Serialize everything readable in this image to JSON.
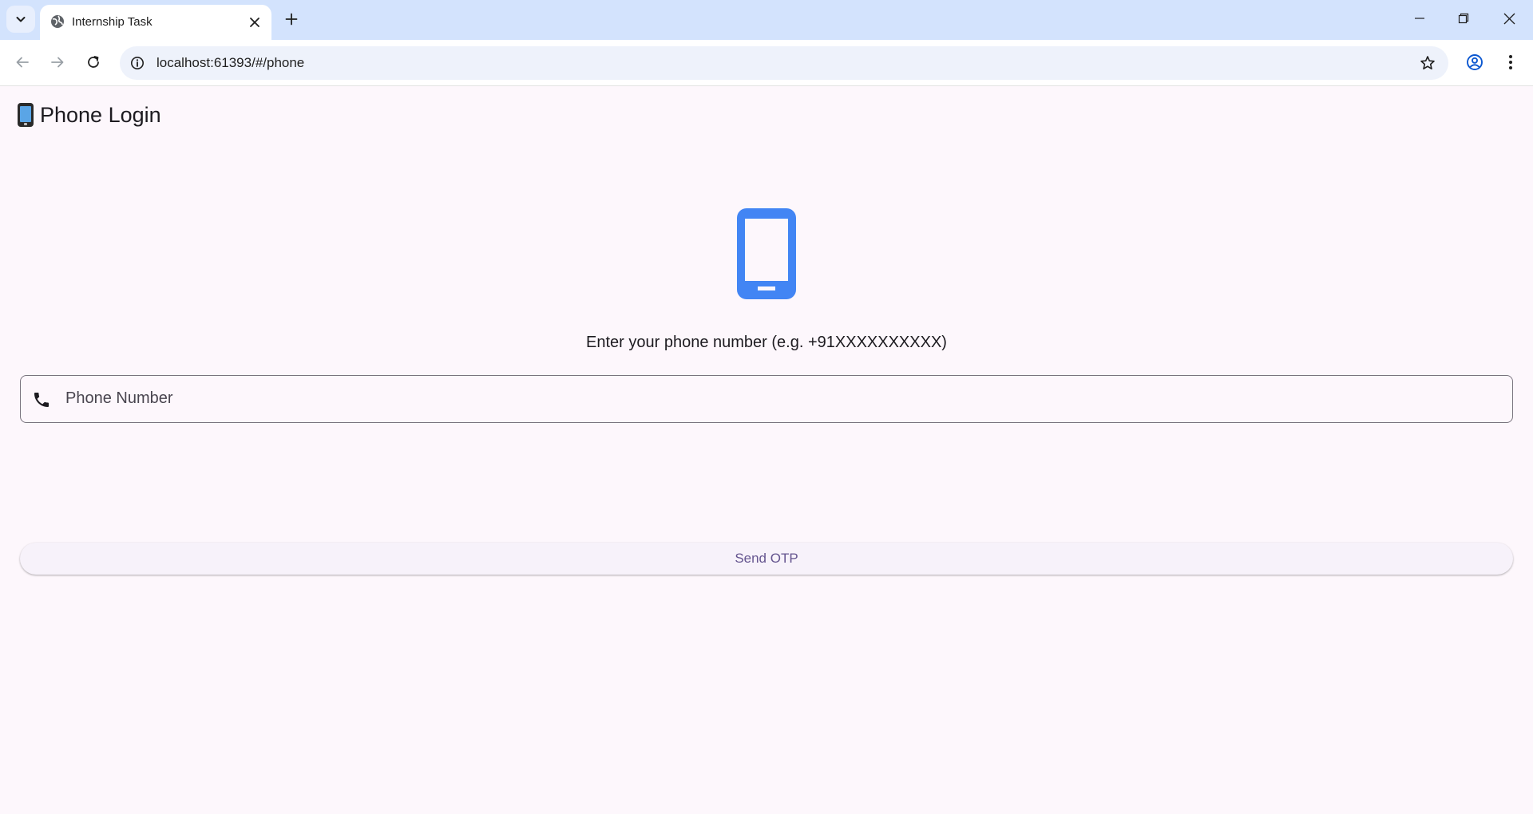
{
  "browser": {
    "tab_title": "Internship Task",
    "url": "localhost:61393/#/phone"
  },
  "app": {
    "title": "Phone Login",
    "instruction": "Enter your phone number (e.g. +91XXXXXXXXXX)",
    "phone_field": {
      "placeholder": "Phone Number",
      "value": ""
    },
    "send_button_label": "Send OTP"
  },
  "colors": {
    "tabstrip": "#d3e3fd",
    "page_background": "#fdf7fc",
    "icon_blue": "#4285f4",
    "button_text": "#65558f"
  },
  "icons": {
    "tab_search": "chevron-down-icon",
    "favicon": "globe-icon",
    "tab_close": "close-icon",
    "new_tab": "plus-icon",
    "back": "arrow-left-icon",
    "forward": "arrow-right-icon",
    "reload": "reload-icon",
    "site_info": "info-icon",
    "bookmark": "star-icon",
    "profile": "account-icon",
    "menu": "kebab-menu-icon",
    "hero": "smartphone-icon",
    "field_prefix": "phone-icon"
  }
}
